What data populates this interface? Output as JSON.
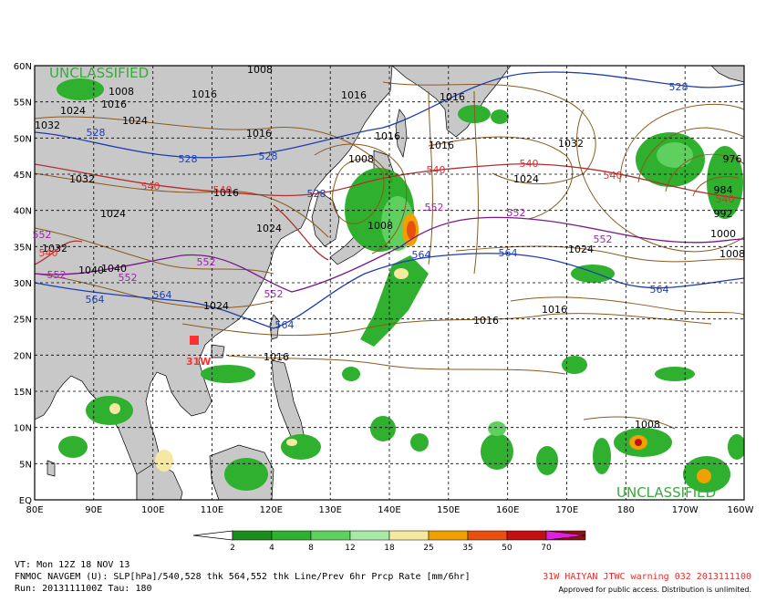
{
  "map": {
    "classification_top": "UNCLASSIFIED",
    "classification_bottom": "UNCLASSIFIED",
    "lat_labels": [
      "60N",
      "55N",
      "50N",
      "45N",
      "40N",
      "35N",
      "30N",
      "25N",
      "20N",
      "15N",
      "10N",
      "5N",
      "EQ"
    ],
    "lon_labels": [
      "80E",
      "90E",
      "100E",
      "110E",
      "120E",
      "130E",
      "140E",
      "150E",
      "160E",
      "170E",
      "180",
      "170W",
      "160W"
    ],
    "storm_label": "31W",
    "isobar_labels": [
      "1008",
      "1008",
      "1016",
      "1016",
      "1016",
      "1016",
      "1024",
      "1024",
      "1032",
      "1032",
      "1032",
      "1024",
      "1016",
      "1016",
      "1016",
      "1024",
      "1016",
      "1016",
      "1016",
      "1024",
      "1032",
      "1040",
      "1040",
      "1024",
      "1008",
      "1008",
      "1016",
      "984",
      "992",
      "976",
      "1000",
      "1008",
      "1008",
      "1024"
    ],
    "thk540_labels": [
      "540",
      "540",
      "540",
      "540",
      "540",
      "540",
      "540"
    ],
    "thk528_labels": [
      "528",
      "528",
      "528",
      "528",
      "528"
    ],
    "thk552_labels": [
      "552",
      "552",
      "552",
      "552",
      "552",
      "552",
      "552",
      "552"
    ],
    "thk564_labels": [
      "564",
      "564",
      "564",
      "564",
      "564",
      "564"
    ],
    "colors": {
      "land": "#c8c8c8",
      "ocean": "#ffffff",
      "isobar": "#8b5a1e",
      "thk_blue": "#1f3fb0",
      "thk_red": "#b03030",
      "thk_purple": "#7a1a8a",
      "classification": "#3aaa3a",
      "warning": "#e03030"
    }
  },
  "colorbar": {
    "ticks": [
      "2",
      "4",
      "8",
      "12",
      "18",
      "25",
      "35",
      "50",
      "70"
    ],
    "colors": [
      "#1c8c1c",
      "#2fb02f",
      "#5fd05f",
      "#a8e8a8",
      "#f5e8a0",
      "#f0a000",
      "#e85010",
      "#c01010",
      "#901010",
      "#e020e0"
    ]
  },
  "footer": {
    "vt": "VT: Mon 12Z 18 NOV 13",
    "model": "FNMOC NAVGEM (U): SLP[hPa]/540,528 thk 564,552 thk Line/Prev 6hr Prcp Rate [mm/6hr]",
    "run": "Run: 2013111100Z Tau: 180",
    "warning": "31W HAIYAN JTWC warning 032 2013111100",
    "approved": "Approved for public access. Distribution is unlimited."
  }
}
